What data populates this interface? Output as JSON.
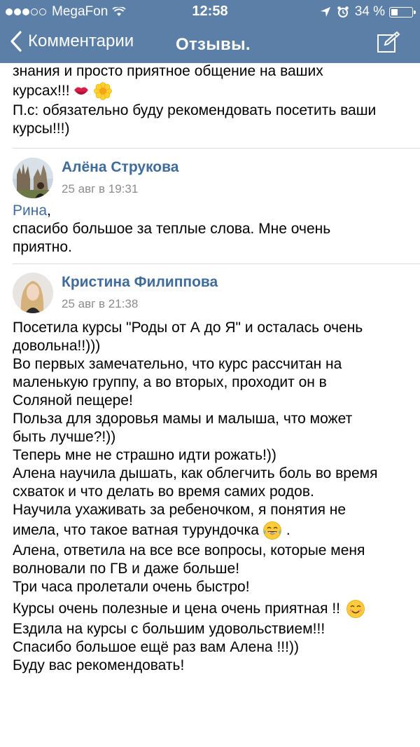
{
  "status_bar": {
    "carrier": "MegaFon",
    "time": "12:58",
    "battery": "34 %",
    "battery_level": 0.34
  },
  "nav": {
    "back_label": "Комментарии",
    "title": "Отзывы."
  },
  "top_comment": {
    "lines": [
      "знания и просто приятное общение на ваших",
      "курсах!!!",
      "П.с: обязательно буду рекомендовать посетить ваши",
      "курсы!!!)"
    ],
    "emojis": [
      "lips-emoji",
      "flower-emoji"
    ]
  },
  "comments": [
    {
      "author": "Алёна Струкова",
      "date": "25 авг в 19:31",
      "mention": "Рина",
      "lines": [
        "спасибо большое за теплые слова. Мне очень",
        "приятно."
      ]
    },
    {
      "author": "Кристина Филиппова",
      "date": "25 авг в 21:38",
      "lines": [
        "Посетила курсы \"Роды от А до Я\" и осталась очень",
        "довольна!!)))",
        "Во первых замечательно, что курс  рассчитан на",
        "маленькую группу, а во вторых, проходит он в",
        "Соляной пещере!",
        "Польза для здоровья мамы и малыша, что может",
        "быть лучше?!))",
        "Теперь мне не страшно идти рожать!))",
        "Алена научила дышать, как облегчить боль во время",
        "схваток и что делать во время самих родов.",
        "Научила ухаживать за ребеночком, я понятия не",
        "имела, что такое ватная турундочка",
        ".",
        "Алена, ответила на все все вопросы, которые меня",
        "волновали по ГВ и даже больше!",
        "Три часа пролетали очень быстро!",
        "Курсы очень полезные и цена очень приятная !!",
        "Ездила на курсы с большим удовольствием!!!",
        "Спасибо большое ещё раз вам Алена !!!))",
        "Буду вас рекомендовать!"
      ]
    }
  ]
}
